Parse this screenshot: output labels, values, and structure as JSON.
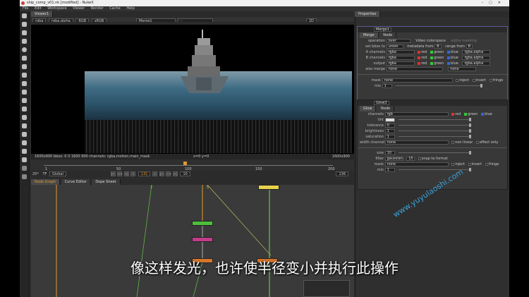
{
  "window": {
    "title": "ship_comp_v01.nk [modified] - NukeX"
  },
  "menu": [
    "File",
    "Edit",
    "Workspace",
    "Viewer",
    "Render",
    "Cache",
    "Help"
  ],
  "viewer": {
    "tab_label": "Viewer1",
    "channels": "rgba",
    "alpha_channel": "rgba.alpha",
    "colorspace": "RGB",
    "display": "sRGB",
    "a_input": "Merge1",
    "b_input": "-",
    "dim_2d": "2D",
    "frame_label": "f/8",
    "gain": "1",
    "y_label": "Y",
    "y_value": "1",
    "info_left": "1600x900  bbox: 0 0 1600 900 channels: rgba,motion,main_mask",
    "info_mid": "x=0 y=0",
    "res_badge": "1600x900"
  },
  "timeline": {
    "start": "1",
    "ticks": [
      "1",
      "50",
      "100",
      "150",
      "200"
    ],
    "ticks_top": [
      "1",
      "30",
      "100",
      "150",
      "200"
    ],
    "fps": "25*",
    "tf": "TF",
    "global": "Global",
    "current_frame": "131",
    "step": "10",
    "end": "136",
    "play_buttons": [
      "|<",
      "<<",
      "<|",
      "<",
      "II",
      ">",
      "|>",
      ">>",
      ">|"
    ]
  },
  "nodegraph": {
    "tabs": [
      "Node Graph",
      "Curve Editor",
      "Dope Sheet"
    ],
    "input_numbers": [
      "1",
      "2",
      "3",
      "5"
    ]
  },
  "properties": {
    "header_title": "Properties",
    "merge": {
      "name": "Merge1",
      "tabs": [
        "Merge",
        "Node"
      ],
      "operation_label": "operation",
      "operation": "over",
      "video_colorspace": "Video colorspace",
      "alpha_masking": "alpha masking",
      "set_bbox_label": "set bbox to",
      "set_bbox": "union",
      "metadata_label": "metadata from",
      "metadata": "B",
      "range_label": "range from",
      "range": "B",
      "a_channels_label": "A channels",
      "a_channels": "rgba",
      "b_channels_label": "B channels",
      "b_channels": "rgba",
      "output_label": "output",
      "output": "rgba",
      "also_merge_label": "also merge",
      "also_merge": "none",
      "also_merge2": "none",
      "rgb_checks": [
        "red",
        "green",
        "blue"
      ],
      "alpha_field": "rgba.alpha",
      "mask_label": "mask",
      "mask": "none",
      "inject": "inject",
      "invert": "invert",
      "fringe": "fringe",
      "mix_label": "mix",
      "mix": "1"
    },
    "glow": {
      "name": "Glow3",
      "tabs": [
        "Glow",
        "Node"
      ],
      "channels_label": "channels",
      "channels": "rgb",
      "rgb_checks": [
        "red",
        "green",
        "blue"
      ],
      "tint_label": "tint",
      "tolerance_label": "tolerance",
      "tolerance": "0",
      "brightness_label": "brightness",
      "brightness": "1",
      "saturation_label": "saturation",
      "saturation": "1",
      "width_label": "width channel",
      "width": "none",
      "non_linear": "non linear",
      "effect_only": "effect only",
      "size_label": "size",
      "size": "10",
      "filter_label": "filter",
      "filter": "gaussian",
      "filter_num": "15",
      "snap": "snap to format",
      "mask_label": "mask",
      "mask": "none",
      "inject": "inject",
      "invert": "invert",
      "fringe": "fringe",
      "mix_label": "mix",
      "mix": "1"
    }
  },
  "overlay": {
    "subtitle": "像这样发光，也许使半径变小并执行此操作",
    "watermark": "www.yuyulaoshi.com"
  },
  "colors": {
    "accent_orange": "#e39a2c",
    "node_green": "#4fbf3c",
    "node_pink": "#c33c8a",
    "node_orange": "#d4762c",
    "node_yellow": "#e8d24a",
    "wire_green": "#6edc4c",
    "selected_outline": "#ff7f00"
  }
}
